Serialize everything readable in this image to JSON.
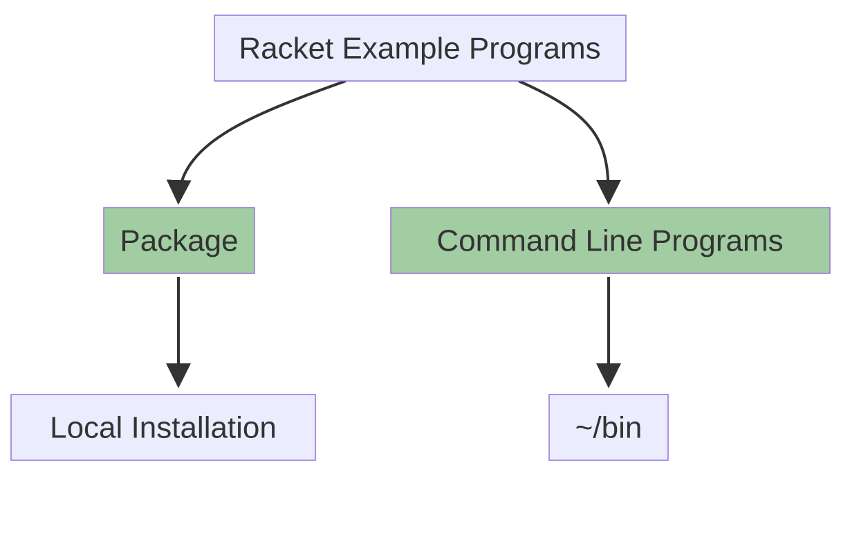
{
  "diagram": {
    "type": "flowchart",
    "nodes": {
      "root": {
        "id": "root",
        "label": "Racket Example Programs",
        "style": "light"
      },
      "package": {
        "id": "package",
        "label": "Package",
        "style": "green"
      },
      "cli": {
        "id": "cli",
        "label": "Command Line Programs",
        "style": "green"
      },
      "local": {
        "id": "local",
        "label": "Local Installation",
        "style": "light"
      },
      "bin": {
        "id": "bin",
        "label": "~/bin",
        "style": "light"
      }
    },
    "edges": [
      {
        "from": "root",
        "to": "package"
      },
      {
        "from": "root",
        "to": "cli"
      },
      {
        "from": "package",
        "to": "local"
      },
      {
        "from": "cli",
        "to": "bin"
      }
    ],
    "colors": {
      "light_fill": "#ECECFF",
      "green_fill": "#A2CDA2",
      "border": "#9370DB",
      "edge": "#333333",
      "text": "#333333"
    }
  }
}
